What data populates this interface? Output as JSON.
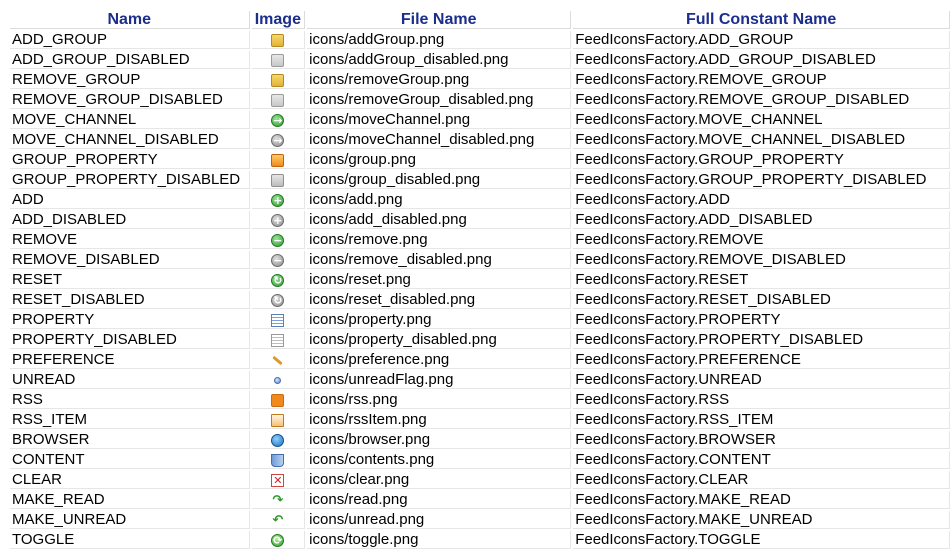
{
  "headers": {
    "name": "Name",
    "image": "Image",
    "file": "File Name",
    "constant": "Full Constant Name"
  },
  "rows": [
    {
      "name": "ADD_GROUP",
      "icon": "folder-icon",
      "file": "icons/addGroup.png",
      "constant": "FeedIconsFactory.ADD_GROUP"
    },
    {
      "name": "ADD_GROUP_DISABLED",
      "icon": "folder-disabled-icon",
      "file": "icons/addGroup_disabled.png",
      "constant": "FeedIconsFactory.ADD_GROUP_DISABLED"
    },
    {
      "name": "REMOVE_GROUP",
      "icon": "folder-icon",
      "file": "icons/removeGroup.png",
      "constant": "FeedIconsFactory.REMOVE_GROUP"
    },
    {
      "name": "REMOVE_GROUP_DISABLED",
      "icon": "folder-disabled-icon",
      "file": "icons/removeGroup_disabled.png",
      "constant": "FeedIconsFactory.REMOVE_GROUP_DISABLED"
    },
    {
      "name": "MOVE_CHANNEL",
      "icon": "move-arrow-icon",
      "file": "icons/moveChannel.png",
      "constant": "FeedIconsFactory.MOVE_CHANNEL"
    },
    {
      "name": "MOVE_CHANNEL_DISABLED",
      "icon": "move-arrow-disabled-icon",
      "file": "icons/moveChannel_disabled.png",
      "constant": "FeedIconsFactory.MOVE_CHANNEL_DISABLED"
    },
    {
      "name": "GROUP_PROPERTY",
      "icon": "group-property-icon",
      "file": "icons/group.png",
      "constant": "FeedIconsFactory.GROUP_PROPERTY"
    },
    {
      "name": "GROUP_PROPERTY_DISABLED",
      "icon": "group-property-disabled-icon",
      "file": "icons/group_disabled.png",
      "constant": "FeedIconsFactory.GROUP_PROPERTY_DISABLED"
    },
    {
      "name": "ADD",
      "icon": "add-icon",
      "file": "icons/add.png",
      "constant": "FeedIconsFactory.ADD"
    },
    {
      "name": "ADD_DISABLED",
      "icon": "add-disabled-icon",
      "file": "icons/add_disabled.png",
      "constant": "FeedIconsFactory.ADD_DISABLED"
    },
    {
      "name": "REMOVE",
      "icon": "remove-icon",
      "file": "icons/remove.png",
      "constant": "FeedIconsFactory.REMOVE"
    },
    {
      "name": "REMOVE_DISABLED",
      "icon": "remove-disabled-icon",
      "file": "icons/remove_disabled.png",
      "constant": "FeedIconsFactory.REMOVE_DISABLED"
    },
    {
      "name": "RESET",
      "icon": "reset-icon",
      "file": "icons/reset.png",
      "constant": "FeedIconsFactory.RESET"
    },
    {
      "name": "RESET_DISABLED",
      "icon": "reset-disabled-icon",
      "file": "icons/reset_disabled.png",
      "constant": "FeedIconsFactory.RESET_DISABLED"
    },
    {
      "name": "PROPERTY",
      "icon": "property-icon",
      "file": "icons/property.png",
      "constant": "FeedIconsFactory.PROPERTY"
    },
    {
      "name": "PROPERTY_DISABLED",
      "icon": "property-disabled-icon",
      "file": "icons/property_disabled.png",
      "constant": "FeedIconsFactory.PROPERTY_DISABLED"
    },
    {
      "name": "PREFERENCE",
      "icon": "wrench-icon",
      "file": "icons/preference.png",
      "constant": "FeedIconsFactory.PREFERENCE"
    },
    {
      "name": "UNREAD",
      "icon": "unread-flag-icon",
      "file": "icons/unreadFlag.png",
      "constant": "FeedIconsFactory.UNREAD"
    },
    {
      "name": "RSS",
      "icon": "rss-icon",
      "file": "icons/rss.png",
      "constant": "FeedIconsFactory.RSS"
    },
    {
      "name": "RSS_ITEM",
      "icon": "rss-item-icon",
      "file": "icons/rssItem.png",
      "constant": "FeedIconsFactory.RSS_ITEM"
    },
    {
      "name": "BROWSER",
      "icon": "browser-icon",
      "file": "icons/browser.png",
      "constant": "FeedIconsFactory.BROWSER"
    },
    {
      "name": "CONTENT",
      "icon": "contents-icon",
      "file": "icons/contents.png",
      "constant": "FeedIconsFactory.CONTENT"
    },
    {
      "name": "CLEAR",
      "icon": "clear-icon",
      "file": "icons/clear.png",
      "constant": "FeedIconsFactory.CLEAR"
    },
    {
      "name": "MAKE_READ",
      "icon": "read-arrow-icon",
      "file": "icons/read.png",
      "constant": "FeedIconsFactory.MAKE_READ"
    },
    {
      "name": "MAKE_UNREAD",
      "icon": "unread-arrow-icon",
      "file": "icons/unread.png",
      "constant": "FeedIconsFactory.MAKE_UNREAD"
    },
    {
      "name": "TOGGLE",
      "icon": "toggle-icon",
      "file": "icons/toggle.png",
      "constant": "FeedIconsFactory.TOGGLE"
    }
  ]
}
